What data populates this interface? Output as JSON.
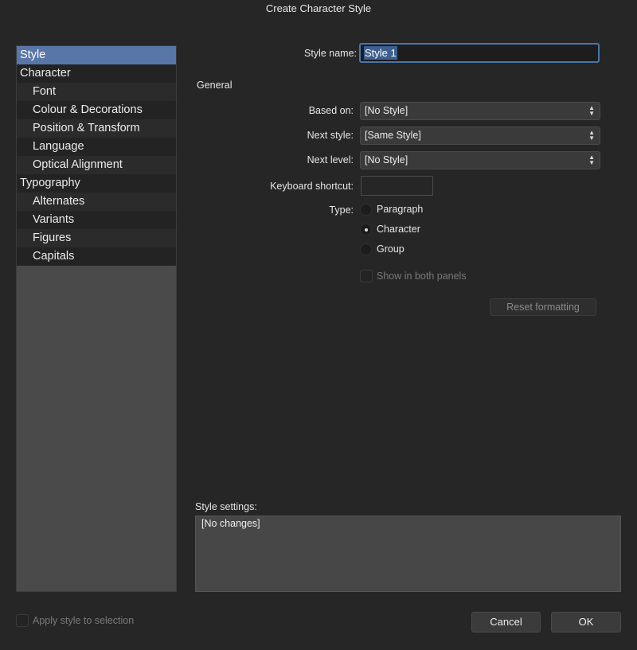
{
  "window": {
    "title": "Create Character Style"
  },
  "sidebar": {
    "items": [
      {
        "label": "Style",
        "selected": true
      },
      {
        "label": "Character"
      },
      {
        "label": "Font"
      },
      {
        "label": "Colour & Decorations"
      },
      {
        "label": "Position & Transform"
      },
      {
        "label": "Language"
      },
      {
        "label": "Optical Alignment"
      },
      {
        "label": "Typography"
      },
      {
        "label": "Alternates"
      },
      {
        "label": "Variants"
      },
      {
        "label": "Figures"
      },
      {
        "label": "Capitals"
      }
    ]
  },
  "form": {
    "style_name_label": "Style name:",
    "style_name_value": "Style 1",
    "general_heading": "General",
    "based_on_label": "Based on:",
    "based_on_value": "[No Style]",
    "next_style_label": "Next style:",
    "next_style_value": "[Same Style]",
    "next_level_label": "Next level:",
    "next_level_value": "[No Style]",
    "shortcut_label": "Keyboard shortcut:",
    "shortcut_value": "",
    "type_label": "Type:",
    "type_options": [
      "Paragraph",
      "Character",
      "Group"
    ],
    "type_selected": "Character",
    "show_both_panels_label": "Show in both panels",
    "reset_label": "Reset formatting"
  },
  "settings": {
    "label": "Style settings:",
    "value": "[No changes]"
  },
  "footer": {
    "apply_label": "Apply style to selection",
    "cancel_label": "Cancel",
    "ok_label": "OK"
  },
  "colors": {
    "accent": "#5877a8",
    "background": "#262626"
  }
}
